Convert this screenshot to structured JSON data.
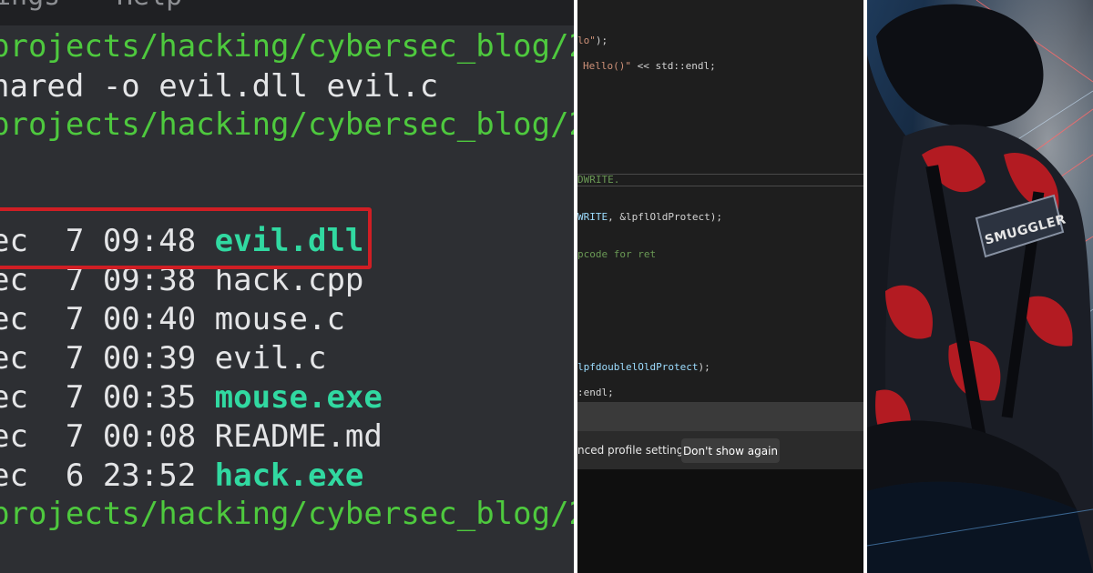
{
  "terminal": {
    "menu_items": [
      "ings",
      "Help"
    ],
    "lines": [
      {
        "kind": "prompt",
        "text": "projects/hacking/cybersec_blog/2"
      },
      {
        "kind": "cmd",
        "text": "nared -o evil.dll evil.c"
      },
      {
        "kind": "prompt",
        "text": "projects/hacking/cybersec_blog/2"
      }
    ],
    "files": [
      {
        "prefix": "ec",
        "day": "7",
        "time": "09:48",
        "name": "evil.dll",
        "executable": true
      },
      {
        "prefix": "ec",
        "day": "7",
        "time": "09:38",
        "name": "hack.cpp",
        "executable": false
      },
      {
        "prefix": "ec",
        "day": "7",
        "time": "00:40",
        "name": "mouse.c",
        "executable": false
      },
      {
        "prefix": "ec",
        "day": "7",
        "time": "00:39",
        "name": "evil.c",
        "executable": false
      },
      {
        "prefix": "ec",
        "day": "7",
        "time": "00:35",
        "name": "mouse.exe",
        "executable": true
      },
      {
        "prefix": "ec",
        "day": "7",
        "time": "00:08",
        "name": "README.md",
        "executable": false
      },
      {
        "prefix": "ec",
        "day": "6",
        "time": "23:52",
        "name": "hack.exe",
        "executable": true
      }
    ],
    "last_prompt": "projects/hacking/cybersec_blog/2",
    "colors": {
      "prompt": "#4ec93e",
      "executable": "#31d9a1",
      "highlight": "#d01e24"
    }
  },
  "editor": {
    "code_lines": [
      {
        "str": "lo\"",
        "rest": ");"
      },
      {
        "str": "Hello()\"",
        "rest": " << std::endl;"
      },
      {
        "cmt": "DWRITE."
      },
      {
        "var": "WRITE",
        "rest": ", &lpflOldProtect);"
      },
      {
        "cmt": "pcode for ret"
      },
      {
        "var": "lpfdoublelOldProtect",
        "rest": ");"
      },
      {
        "plain": ":endl;"
      }
    ],
    "notification": {
      "text": "nced profile settings.",
      "button_label": "Don't show again"
    }
  },
  "illustration": {
    "patch_label": "SMUGGLER"
  }
}
